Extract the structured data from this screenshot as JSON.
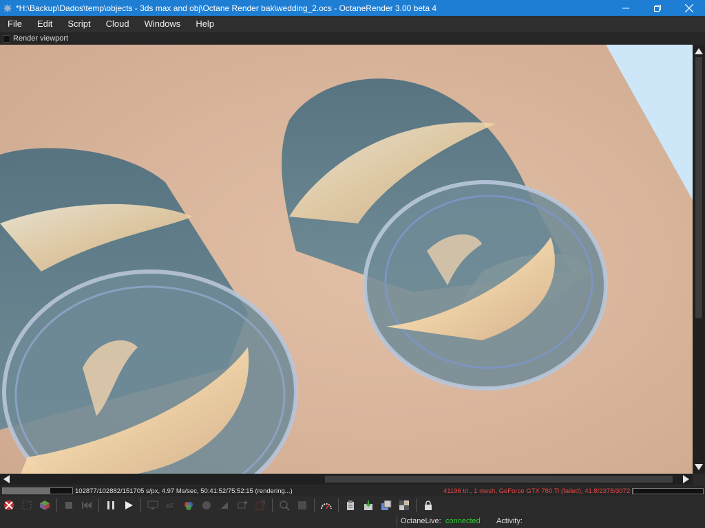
{
  "window": {
    "title": "*H:\\Backup\\Dados\\temp\\objects - 3ds max and obj\\Octane Render bak\\wedding_2.ocs - OctaneRender 3.00 beta 4"
  },
  "menu": [
    "File",
    "Edit",
    "Script",
    "Cloud",
    "Windows",
    "Help"
  ],
  "viewport": {
    "header_label": "Render viewport"
  },
  "status": {
    "progress_fraction": 0.68,
    "render_text": "102877/102882/151705 s/px, 4.97 Ms/sec, 50:41:52/75:52:15 (rendering...)",
    "gpu_text": "41196 tri., 1 mesh, GeForce GTX 780 Ti (failed), 41.8/2378/3072 MB",
    "gpu_text_color": "#e84646"
  },
  "bottom": {
    "octane_live_label": "OctaneLive:",
    "octane_live_value": "connected",
    "octane_live_color": "#2fd02f",
    "activity_label": "Activity:"
  }
}
